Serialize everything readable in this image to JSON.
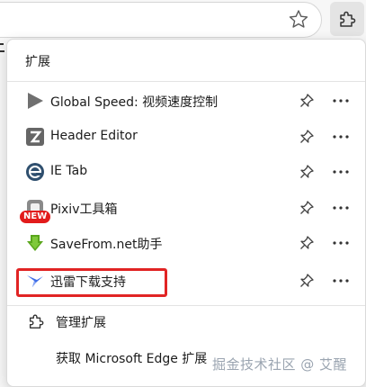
{
  "panel": {
    "title": "扩展"
  },
  "extensions": [
    {
      "name": "Global Speed: 视频速度控制",
      "icon": "play-triangle-icon"
    },
    {
      "name": "Header Editor",
      "icon": "header-editor-icon"
    },
    {
      "name": "IE Tab",
      "icon": "ie-tab-icon"
    },
    {
      "name": "Pixiv工具箱",
      "icon": "pixiv-toolbox-icon",
      "badge": "NEW"
    },
    {
      "name": "SaveFrom.net助手",
      "icon": "download-arrow-icon"
    },
    {
      "name": "迅雷下载支持",
      "icon": "thunder-bird-icon"
    }
  ],
  "footer": {
    "manage_label": "管理扩展",
    "get_label": "获取 Microsoft Edge 扩展"
  },
  "watermark": "掘金技术社区 @ 艾醒",
  "colors": {
    "highlight": "#e12424",
    "badge": "#e21b1b",
    "savefrom_green": "#5aa61c",
    "thunder_blue": "#3f6ee8"
  }
}
